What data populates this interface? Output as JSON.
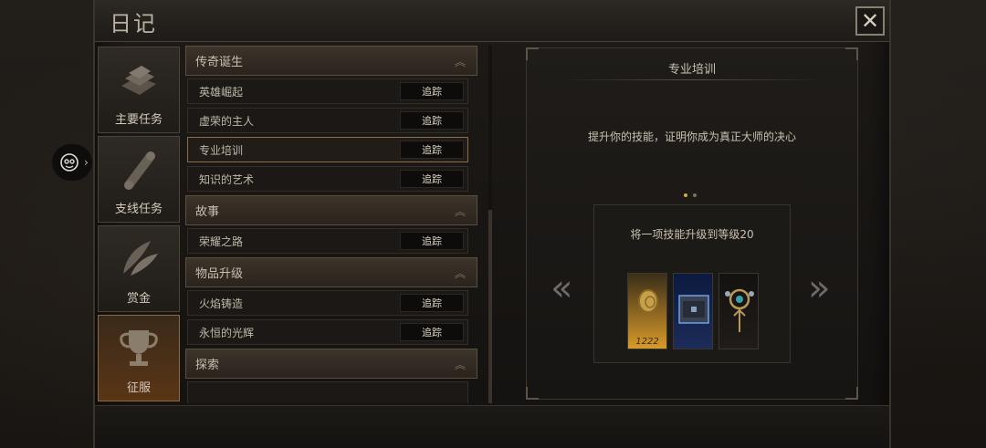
{
  "window": {
    "title": "日记",
    "close_icon": "close-icon"
  },
  "categories": [
    {
      "label": "主要任务",
      "icon": "book-icon",
      "active": false
    },
    {
      "label": "支线任务",
      "icon": "scroll-icon",
      "active": false
    },
    {
      "label": "赏金",
      "icon": "feathers-icon",
      "active": false
    },
    {
      "label": "征服",
      "icon": "trophy-icon",
      "active": true
    }
  ],
  "quest_list": {
    "track_label": "追踪",
    "sections": [
      {
        "title": "传奇诞生",
        "quests": [
          "英雄崛起",
          "虚荣的主人",
          "专业培训",
          "知识的艺术"
        ]
      },
      {
        "title": "故事",
        "quests": [
          "荣耀之路"
        ]
      },
      {
        "title": "物品升级",
        "quests": [
          "火焰铸造",
          "永恒的光辉"
        ]
      },
      {
        "title": "探索",
        "quests": []
      }
    ],
    "selected": "专业培训"
  },
  "detail": {
    "title": "专业培训",
    "description": "提升你的技能，证明你成为真正大师的决心",
    "objective": "将一项技能升级到等级20",
    "rewards": [
      {
        "name": "gold-coins",
        "amount": "1222"
      },
      {
        "name": "chest",
        "amount": ""
      },
      {
        "name": "amulet",
        "amount": ""
      }
    ],
    "page_indicator": {
      "total": 2,
      "current": 1
    }
  },
  "colors": {
    "accent": "#d8a848",
    "active_tab": "#5a3516",
    "panel_border": "#4b4338"
  }
}
